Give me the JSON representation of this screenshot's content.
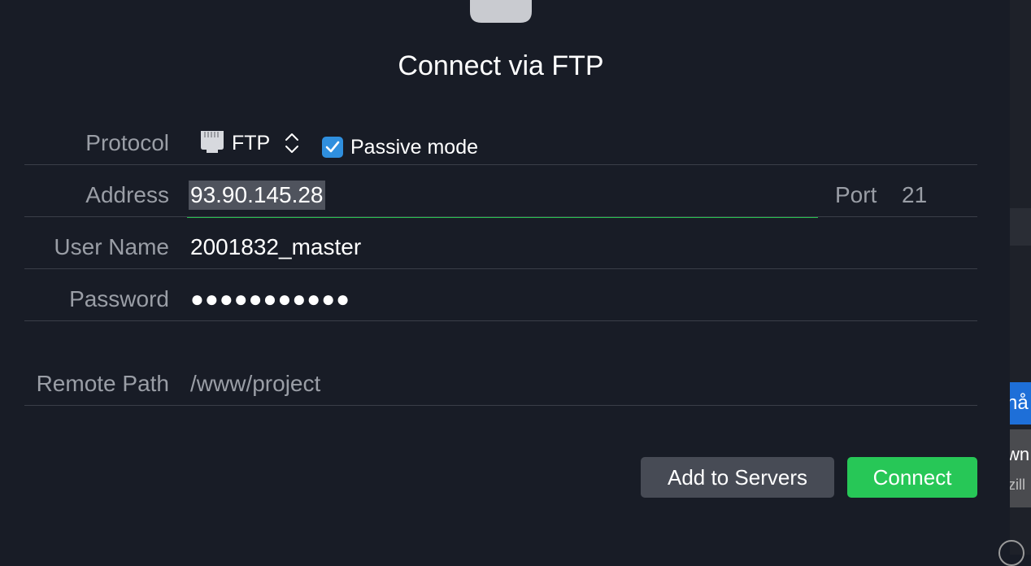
{
  "dialog": {
    "title": "Connect via FTP",
    "protocol": {
      "label": "Protocol",
      "value": "FTP",
      "passive_mode_label": "Passive mode",
      "passive_mode_checked": true
    },
    "address": {
      "label": "Address",
      "value": "93.90.145.28"
    },
    "port": {
      "label": "Port",
      "value": "21"
    },
    "username": {
      "label": "User Name",
      "value": "2001832_master"
    },
    "password": {
      "label": "Password",
      "value": "●●●●●●●●●●●"
    },
    "remote_path": {
      "label": "Remote Path",
      "placeholder": "/www/project"
    },
    "buttons": {
      "add_to_servers": "Add to Servers",
      "connect": "Connect"
    }
  },
  "background_window": {
    "blue_button_fragment": "nå",
    "item_title_fragment": "wn",
    "item_subtitle_fragment": "zill"
  },
  "colors": {
    "background": "#181c26",
    "accent_green": "#27c757",
    "checkbox_blue": "#2f8fde",
    "secondary_button": "#474b55"
  }
}
